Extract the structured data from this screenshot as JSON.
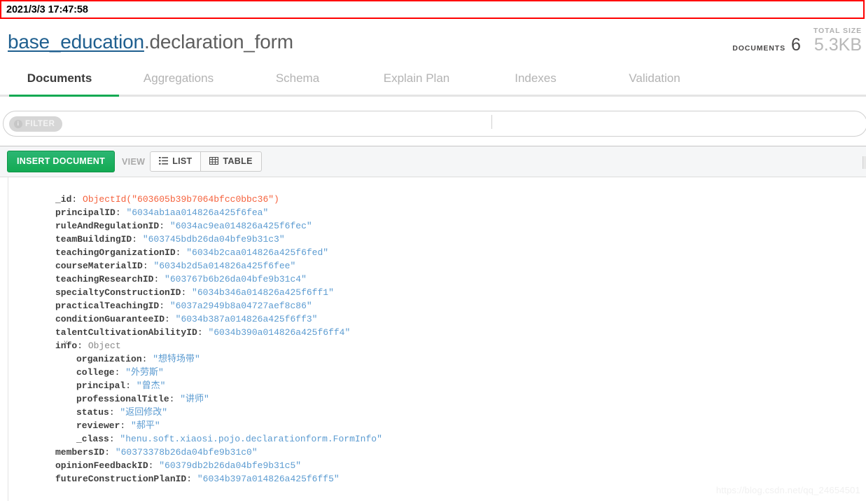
{
  "capture": {
    "timestamp": "2021/3/3 17:47:58"
  },
  "header": {
    "database": "base_education",
    "separator": ".",
    "collection": "declaration_form",
    "stats": {
      "documents_label": "DOCUMENTS",
      "documents_value": "6",
      "total_size_label": "TOTAL SIZE",
      "total_size_value": "5.3KB"
    }
  },
  "tabs": [
    {
      "label": "Documents",
      "active": true
    },
    {
      "label": "Aggregations",
      "active": false
    },
    {
      "label": "Schema",
      "active": false
    },
    {
      "label": "Explain Plan",
      "active": false
    },
    {
      "label": "Indexes",
      "active": false
    },
    {
      "label": "Validation",
      "active": false
    }
  ],
  "filter": {
    "pill_label": "FILTER",
    "info_icon": "info-icon",
    "value": "",
    "placeholder": ""
  },
  "toolbar": {
    "insert_label": "INSERT DOCUMENT",
    "view_label": "VIEW",
    "list_label": "LIST",
    "table_label": "TABLE",
    "list_icon": "list-icon",
    "table_icon": "table-icon"
  },
  "document": {
    "expand_caret": "˅",
    "fields": [
      {
        "key": "_id",
        "value": "ObjectId(\"603605b39b7064bfcc0bbc36\")",
        "type": "objectid",
        "indent": 0
      },
      {
        "key": "principalID",
        "value": "\"6034ab1aa014826a425f6fea\"",
        "type": "string",
        "indent": 0
      },
      {
        "key": "ruleAndRegulationID",
        "value": "\"6034ac9ea014826a425f6fec\"",
        "type": "string",
        "indent": 0
      },
      {
        "key": "teamBuildingID",
        "value": "\"603745bdb26da04bfe9b31c3\"",
        "type": "string",
        "indent": 0
      },
      {
        "key": "teachingOrganizationID",
        "value": "\"6034b2caa014826a425f6fed\"",
        "type": "string",
        "indent": 0
      },
      {
        "key": "courseMaterialID",
        "value": "\"6034b2d5a014826a425f6fee\"",
        "type": "string",
        "indent": 0
      },
      {
        "key": "teachingResearchID",
        "value": "\"603767b6b26da04bfe9b31c4\"",
        "type": "string",
        "indent": 0
      },
      {
        "key": "specialtyConstructionID",
        "value": "\"6034b346a014826a425f6ff1\"",
        "type": "string",
        "indent": 0
      },
      {
        "key": "practicalTeachingID",
        "value": "\"6037a2949b8a04727aef8c86\"",
        "type": "string",
        "indent": 0
      },
      {
        "key": "conditionGuaranteeID",
        "value": "\"6034b387a014826a425f6ff3\"",
        "type": "string",
        "indent": 0
      },
      {
        "key": "talentCultivationAbilityID",
        "value": "\"6034b390a014826a425f6ff4\"",
        "type": "string",
        "indent": 0
      },
      {
        "key": "info",
        "value": "Object",
        "type": "type",
        "indent": 0,
        "expandable": true,
        "expanded": true
      },
      {
        "key": "organization",
        "value": "\"想特场带\"",
        "type": "string",
        "indent": 1
      },
      {
        "key": "college",
        "value": "\"外劳斯\"",
        "type": "string",
        "indent": 1
      },
      {
        "key": "principal",
        "value": "\"曾杰\"",
        "type": "string",
        "indent": 1
      },
      {
        "key": "professionalTitle",
        "value": "\"讲师\"",
        "type": "string",
        "indent": 1
      },
      {
        "key": "status",
        "value": "\"返回修改\"",
        "type": "string",
        "indent": 1
      },
      {
        "key": "reviewer",
        "value": "\"郝平\"",
        "type": "string",
        "indent": 1
      },
      {
        "key": "_class",
        "value": "\"henu.soft.xiaosi.pojo.declarationform.FormInfo\"",
        "type": "string",
        "indent": 1
      },
      {
        "key": "membersID",
        "value": "\"60373378b26da04bfe9b31c0\"",
        "type": "string",
        "indent": 0
      },
      {
        "key": "opinionFeedbackID",
        "value": "\"60379db2b26da04bfe9b31c5\"",
        "type": "string",
        "indent": 0
      },
      {
        "key": "futureConstructionPlanID",
        "value": "\"6034b397a014826a425f6ff5\"",
        "type": "string",
        "indent": 0
      }
    ]
  },
  "watermark": {
    "text": "https://blog.csdn.net/qq_24654501"
  },
  "colors": {
    "accent_green": "#13aa52",
    "link_blue": "#1f5f8f",
    "string_blue": "#5b9bd1",
    "objectid_orange": "#f5623d",
    "banner_red": "#ff0000"
  }
}
